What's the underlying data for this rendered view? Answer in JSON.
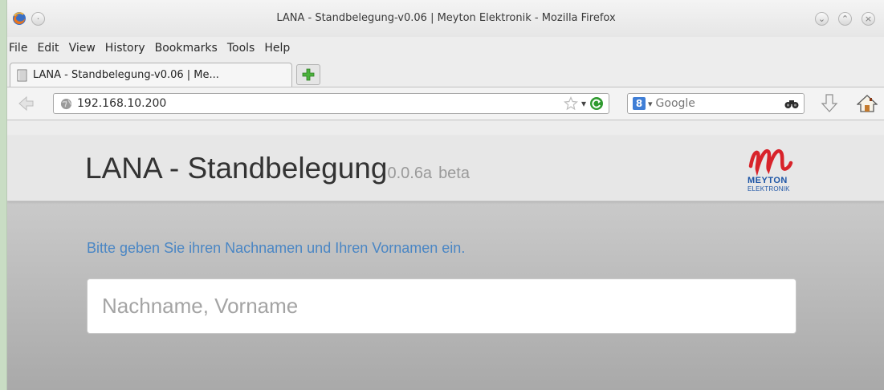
{
  "window": {
    "title": "LANA - Standbelegung-v0.06 | Meyton Elektronik - Mozilla Firefox",
    "controls": [
      "minimize",
      "maximize",
      "close"
    ]
  },
  "menu": {
    "file": "File",
    "edit": "Edit",
    "view": "View",
    "history": "History",
    "bookmarks": "Bookmarks",
    "tools": "Tools",
    "help": "Help"
  },
  "tab": {
    "label": "LANA - Standbelegung-v0.06 | Me..."
  },
  "navbar": {
    "url": "192.168.10.200",
    "search_placeholder": "Google"
  },
  "page": {
    "title": "LANA - Standbelegung",
    "version": "0.0.6a",
    "badge": "beta",
    "logo_text": "MEYTON",
    "logo_subtext": "ELEKTRONIK",
    "instruction": "Bitte geben Sie ihren Nachnamen und Ihren Vornamen ein.",
    "input_placeholder": "Nachname, Vorname"
  },
  "colors": {
    "instruction": "#4a86c4",
    "logo_red": "#d8232a",
    "logo_blue": "#1d55a6"
  }
}
